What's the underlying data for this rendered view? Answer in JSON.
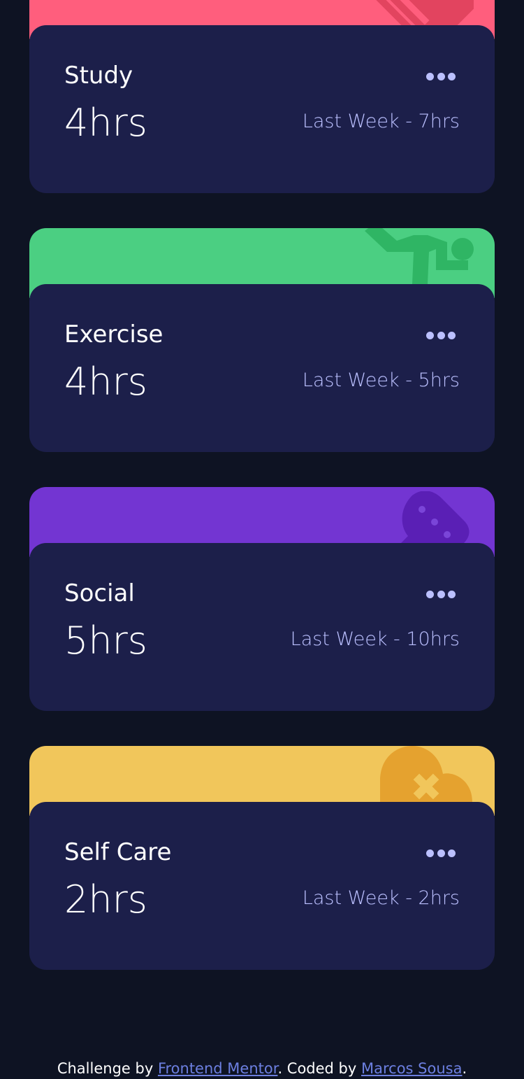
{
  "cards": [
    {
      "title": "Study",
      "hours": "4hrs",
      "previous": "Last Week - 7hrs",
      "icon": "book-icon",
      "accent": "#ff5e7d",
      "icon_color": "#e2445f"
    },
    {
      "title": "Exercise",
      "hours": "4hrs",
      "previous": "Last Week - 5hrs",
      "icon": "running-icon",
      "accent": "#4bcf82",
      "icon_color": "#2fb564"
    },
    {
      "title": "Social",
      "hours": "5hrs",
      "previous": "Last Week - 10hrs",
      "icon": "chat-bubble-icon",
      "accent": "#7335d2",
      "icon_color": "#5a1fb5"
    },
    {
      "title": "Self Care",
      "hours": "2hrs",
      "previous": "Last Week - 2hrs",
      "icon": "heart-icon",
      "accent": "#f1c65b",
      "icon_color": "#e5a22f"
    }
  ],
  "footer": {
    "prefix": "Challenge by ",
    "link1": "Frontend Mentor",
    "middle": ". Coded by ",
    "link2": "Marcos Sousa",
    "suffix": "."
  },
  "colors": {
    "page_bg": "#0e1323",
    "card_bg": "#1c1f4a",
    "muted_text": "#bbc0ff"
  }
}
